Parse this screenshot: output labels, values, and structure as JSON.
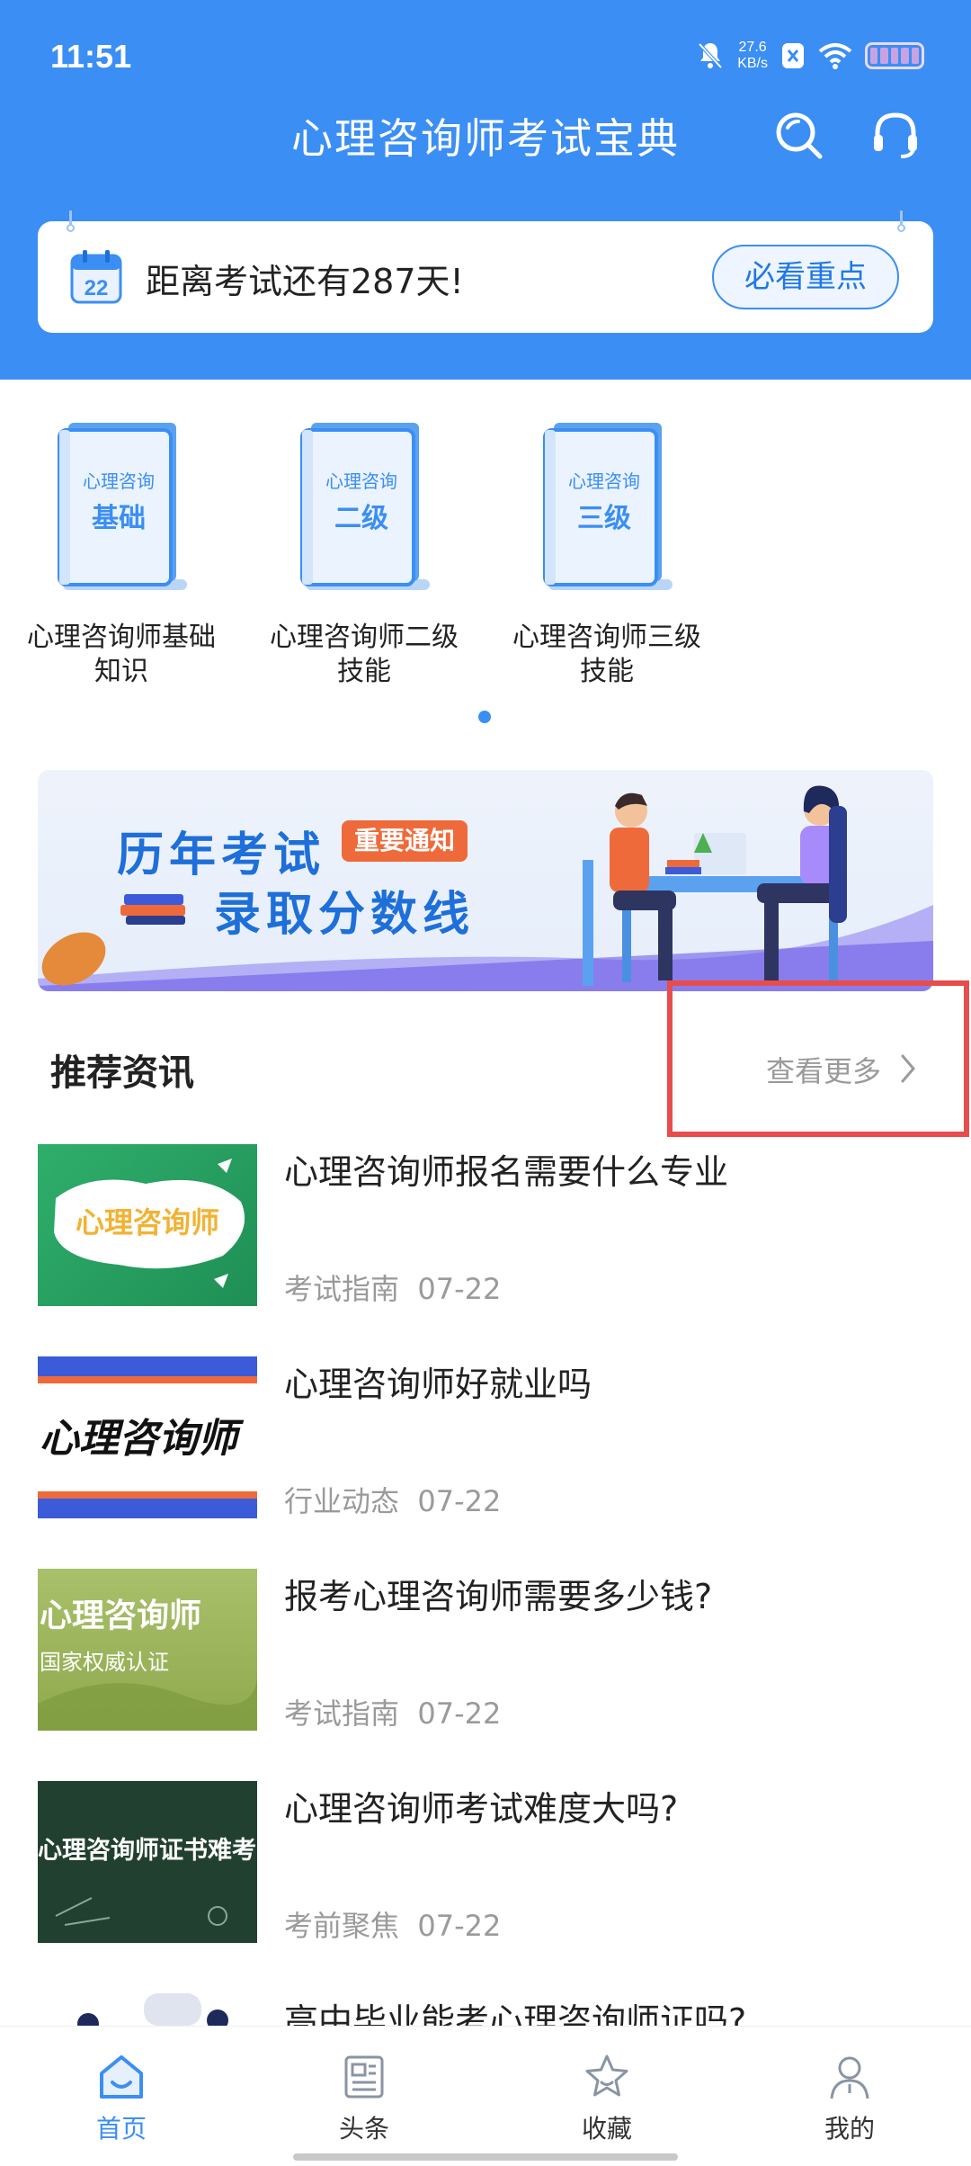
{
  "status_bar": {
    "time": "11:51",
    "net_speed_value": "27.6",
    "net_speed_unit": "KB/s"
  },
  "header": {
    "title": "心理咨询师考试宝典",
    "search_icon": "search-icon",
    "service_icon": "headset-icon"
  },
  "countdown": {
    "calendar_day": "22",
    "text": "距离考试还有287天!",
    "button_label": "必看重点"
  },
  "books": [
    {
      "cover_top": "心理咨询",
      "cover_main": "基础",
      "label": "心理咨询师基础知识"
    },
    {
      "cover_top": "心理咨询",
      "cover_main": "二级",
      "label": "心理咨询师二级技能"
    },
    {
      "cover_top": "心理咨询",
      "cover_main": "三级",
      "label": "心理咨询师三级技能"
    }
  ],
  "banner": {
    "line1": "历年考试",
    "badge": "重要通知",
    "line2": "录取分数线"
  },
  "section": {
    "title": "推荐资讯",
    "more_label": "查看更多"
  },
  "news": [
    {
      "title": "心理咨询师报名需要什么专业",
      "category": "考试指南",
      "date": "07-22",
      "thumb_text": "心理咨询师",
      "thumb_sub": ""
    },
    {
      "title": "心理咨询师好就业吗",
      "category": "行业动态",
      "date": "07-22",
      "thumb_text": "心理咨询师",
      "thumb_sub": ""
    },
    {
      "title": "报考心理咨询师需要多少钱?",
      "category": "考试指南",
      "date": "07-22",
      "thumb_text": "心理咨询师",
      "thumb_sub": "国家权威认证"
    },
    {
      "title": "心理咨询师考试难度大吗?",
      "category": "考前聚焦",
      "date": "07-22",
      "thumb_text": "心理咨询师证书难考",
      "thumb_sub": ""
    },
    {
      "title": "高中毕业能考心理咨询师证吗?",
      "category": "",
      "date": "",
      "thumb_text": "",
      "thumb_sub": ""
    }
  ],
  "nav": [
    {
      "label": "首页",
      "icon": "home-icon",
      "active": true
    },
    {
      "label": "头条",
      "icon": "news-icon",
      "active": false
    },
    {
      "label": "收藏",
      "icon": "star-icon",
      "active": false
    },
    {
      "label": "我的",
      "icon": "profile-icon",
      "active": false
    }
  ],
  "colors": {
    "primary": "#3b8ef3",
    "highlight": "#e84c4c",
    "badge": "#ef6a3a"
  }
}
